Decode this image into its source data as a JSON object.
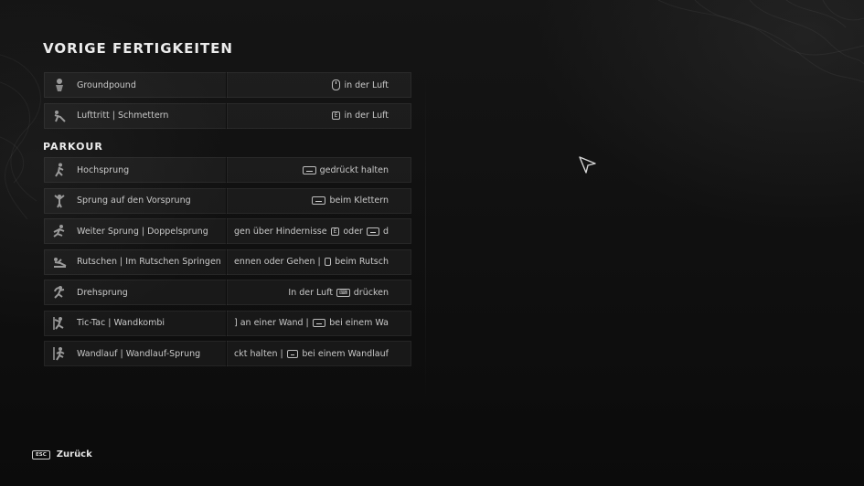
{
  "sections": {
    "previous_title": "VORIGE FERTIGKEITEN",
    "parkour_title": "PARKOUR"
  },
  "previous_skills": [
    {
      "name": "Groundpound",
      "icon": "groundpound-icon",
      "binding": {
        "mouse": true,
        "text": "in der Luft"
      }
    },
    {
      "name": "Lufttritt | Schmettern",
      "icon": "air-kick-icon",
      "binding": {
        "key": "E",
        "text": "in der Luft"
      }
    }
  ],
  "parkour_skills": [
    {
      "name": "Hochsprung",
      "icon": "high-jump-icon",
      "binding": {
        "space": true,
        "text": "gedrückt halten"
      }
    },
    {
      "name": "Sprung auf den Vorsprung",
      "icon": "ledge-jump-icon",
      "binding": {
        "space": true,
        "text": "beim Klettern"
      }
    },
    {
      "name": "Weiter Sprung | Doppelsprung",
      "icon": "long-jump-icon",
      "binding": {
        "pre": "gen über Hindernisse",
        "key": "E",
        "mid": "oder",
        "space": true,
        "post": "d"
      }
    },
    {
      "name": "Rutschen | Im Rutschen Springen",
      "icon": "slide-icon",
      "binding": {
        "pre": "ennen oder Gehen |",
        "space": true,
        "post": "beim Rutsch"
      }
    },
    {
      "name": "Drehsprung",
      "icon": "spin-jump-icon",
      "binding": {
        "pre": "In der Luft",
        "keyboard": true,
        "post": "drücken"
      }
    },
    {
      "name": "Tic-Tac | Wandkombi",
      "icon": "tic-tac-icon",
      "binding": {
        "pre": "] an einer Wand |",
        "space": true,
        "post": "bei einem Wa"
      }
    },
    {
      "name": "Wandlauf | Wandlauf-Sprung",
      "icon": "wall-run-icon",
      "binding": {
        "pre": "ckt halten |",
        "space": true,
        "post": "bei einem Wandlauf"
      }
    }
  ],
  "footer": {
    "esc_key": "ESC",
    "back_label": "Zurück"
  },
  "colors": {
    "background": "#0e0e0e",
    "row_background": "#1b1b1b",
    "text": "#c9c9c9",
    "title": "#ececec"
  }
}
